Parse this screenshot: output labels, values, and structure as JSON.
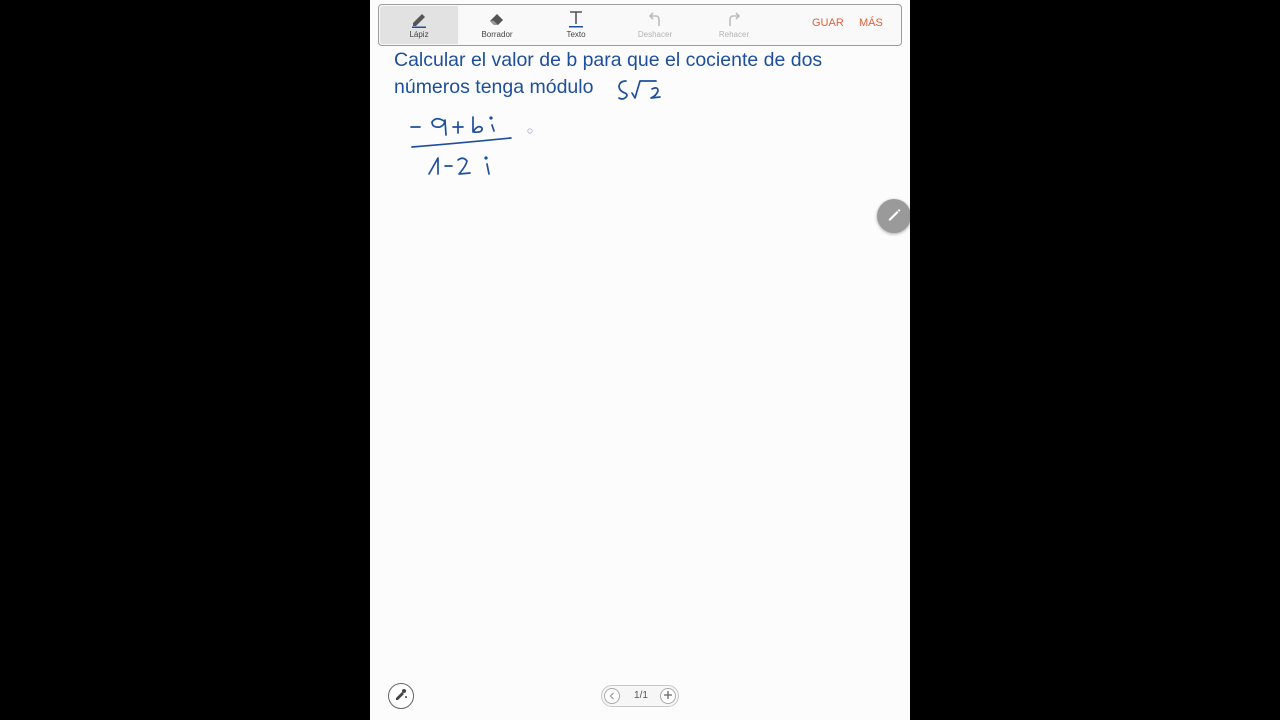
{
  "toolbar": {
    "pencil_label": "Lápiz",
    "eraser_label": "Borrador",
    "text_label": "Texto",
    "undo_label": "Deshacer",
    "redo_label": "Rehacer",
    "save_label": "GUAR",
    "more_label": "MÁS"
  },
  "question": {
    "line1": "Calcular el valor de b para que el cociente de dos",
    "line2": "números tenga módulo"
  },
  "handwriting": {
    "modulus": "5√2",
    "numerator": "-9+bi",
    "denominator": "1-2i"
  },
  "pager": {
    "indicator": "1/1"
  },
  "colors": {
    "ink": "#1d4f9c",
    "accent": "#e2613a",
    "page": "#fcfcfc"
  },
  "icons": {
    "pencil": "pencil-icon",
    "eraser": "eraser-icon",
    "text": "text-icon",
    "undo": "undo-icon",
    "redo": "redo-icon",
    "fab": "pen-icon",
    "bottom": "pen-settings-icon",
    "prev": "chevron-left-icon",
    "add": "plus-icon"
  }
}
